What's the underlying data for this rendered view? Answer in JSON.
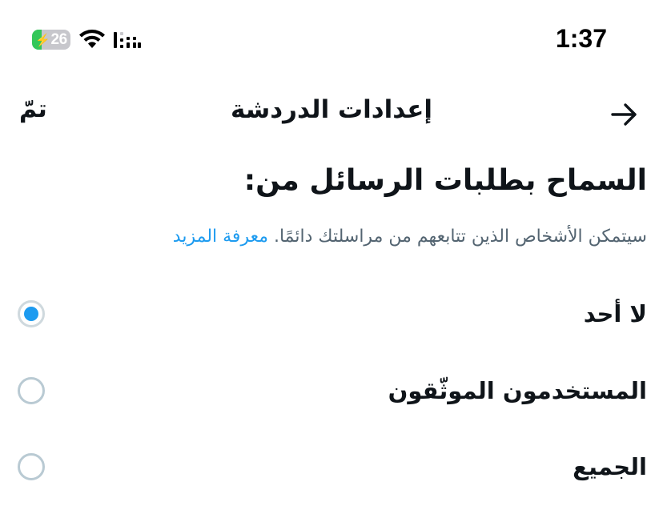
{
  "status_bar": {
    "battery_level": "26",
    "battery_fill_fraction": 0.26,
    "time": "1:37",
    "icons": [
      "bolt-icon",
      "wifi-icon",
      "cellular-signal-icon"
    ]
  },
  "header": {
    "done_label": "تمّ",
    "title": "إعدادات الدردشة",
    "back_icon": "arrow-right-icon"
  },
  "section": {
    "heading": "السماح بطلبات الرسائل من:",
    "description": "سيتمكن الأشخاص الذين تتابعهم من مراسلتك دائمًا.",
    "learn_more": "معرفة المزيد"
  },
  "options": [
    {
      "label": "لا أحد",
      "selected": true
    },
    {
      "label": "المستخدمون الموثّقون",
      "selected": false
    },
    {
      "label": "الجميع",
      "selected": false
    }
  ],
  "colors": {
    "accent": "#1d9bf0",
    "secondary_text": "#536471",
    "battery_fill": "#34c759"
  }
}
